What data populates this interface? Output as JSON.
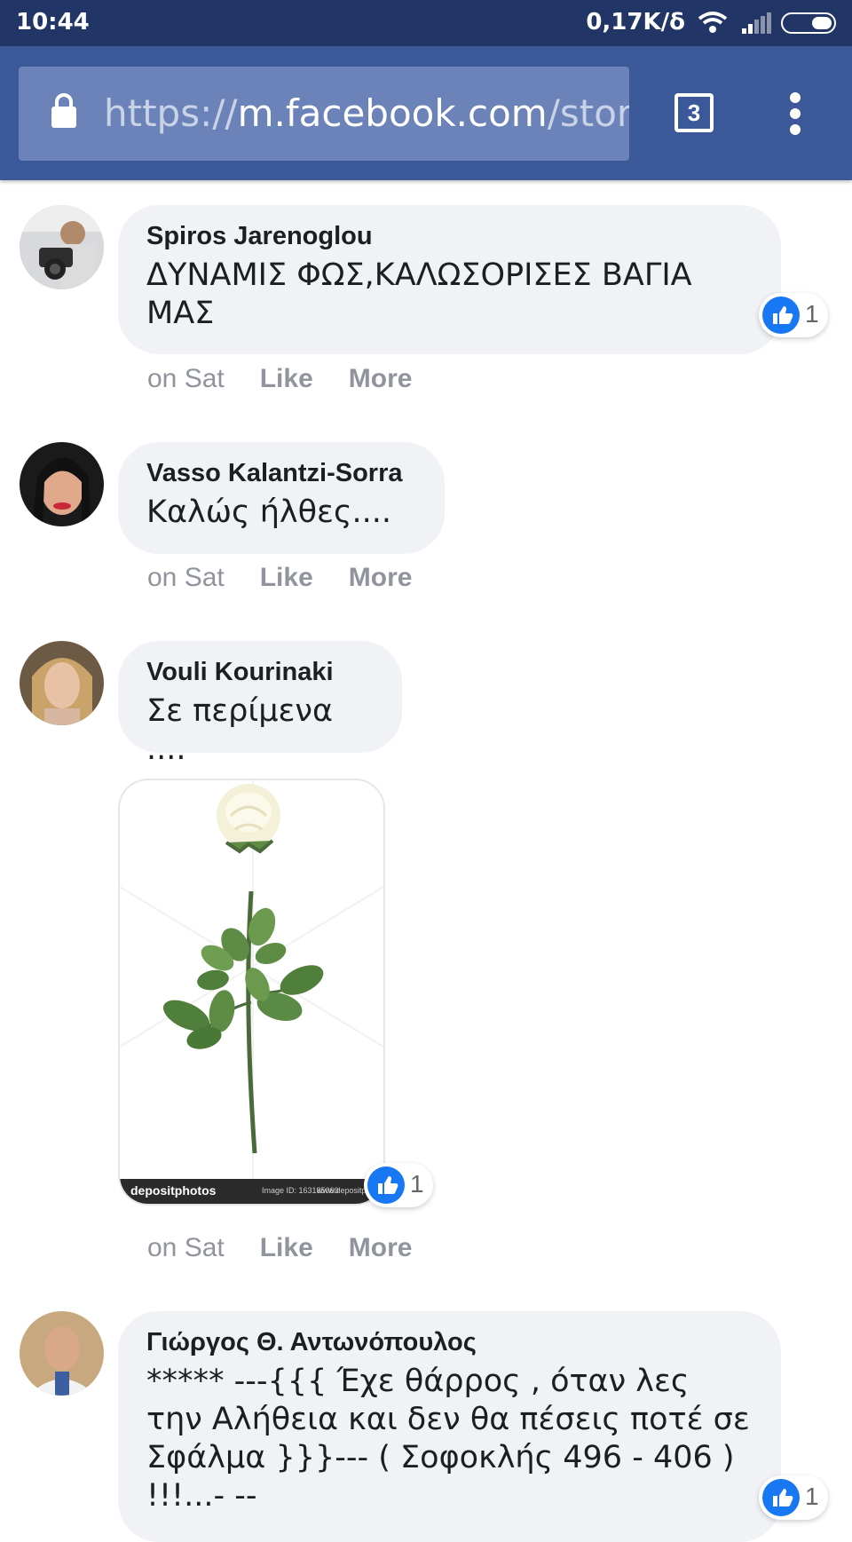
{
  "status_bar": {
    "time": "10:44",
    "network_speed": "0,17K/δ",
    "icons": [
      "wifi-icon",
      "signal-icon",
      "battery-icon"
    ]
  },
  "browser": {
    "url_scheme": "https://",
    "url_host": "m.facebook.com",
    "url_path": "/story.",
    "tab_count": "3",
    "icons": [
      "lock-icon",
      "tabs-icon",
      "overflow-menu-icon"
    ]
  },
  "colors": {
    "facebook_blue": "#3b5998",
    "status_bar": "#223567",
    "like_blue": "#1877f2",
    "bubble_gray": "#f0f2f5"
  },
  "comments": [
    {
      "author": "Spiros Jarenoglou",
      "text": "ΔΥΝΑΜΙΣ ΦΩΣ,ΚΑΛΩΣΟΡΙΣΕΣ ΒΑΓΙΑ ΜΑΣ",
      "time": "on Sat",
      "like": "Like",
      "more": "More",
      "reaction_count": "1"
    },
    {
      "author": "Vasso Kalantzi-Sorra",
      "text": "Καλώς ήλθες....",
      "time": "on Sat",
      "like": "Like",
      "more": "More"
    },
    {
      "author": "Vouli Kourinaki",
      "text": "Σε περίμενα ....",
      "time": "on Sat",
      "like": "Like",
      "more": "More",
      "image": {
        "watermark": "depositphotos",
        "image_id": "Image ID: 163185060",
        "site": "www.depositphotos"
      },
      "reaction_count": "1"
    },
    {
      "author": "Γιώργος Θ. Αντωνόπουλος",
      "text": "***** ---{{{ Έχε θάρρος , όταν λες την Αλήθεια και δεν θα πέσεις ποτέ σε Σφάλμα }}}--- ( Σοφοκλής 496 - 406 ) !!!...- --",
      "reaction_count": "1"
    }
  ]
}
